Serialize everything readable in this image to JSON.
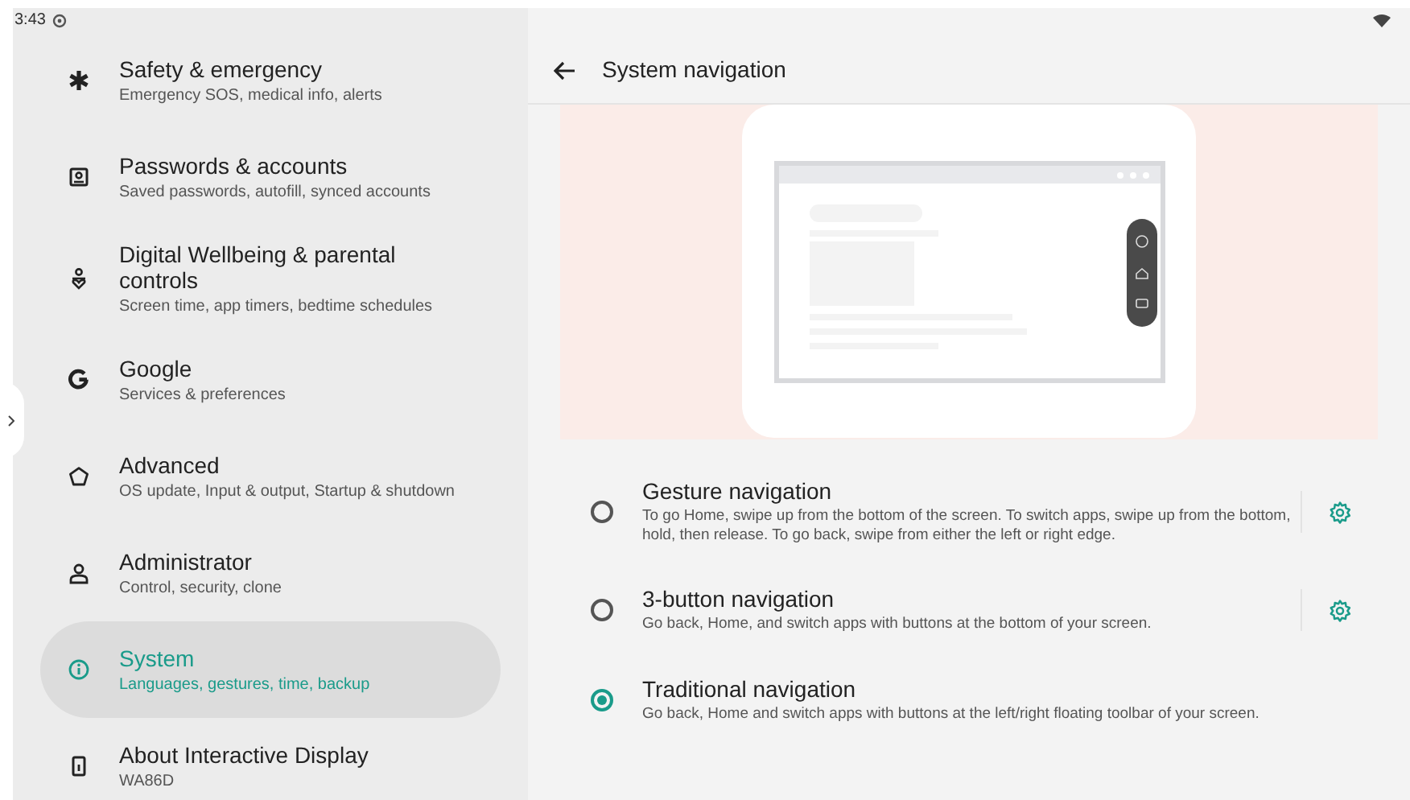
{
  "status_bar": {
    "time": "3:43"
  },
  "sidebar": {
    "items": [
      {
        "title": "Safety & emergency",
        "subtitle": "Emergency SOS, medical info, alerts",
        "selected": false
      },
      {
        "title": "Passwords & accounts",
        "subtitle": "Saved passwords, autofill, synced accounts",
        "selected": false
      },
      {
        "title": "Digital Wellbeing & parental controls",
        "subtitle": "Screen time, app timers, bedtime schedules",
        "selected": false
      },
      {
        "title": "Google",
        "subtitle": "Services & preferences",
        "selected": false
      },
      {
        "title": "Advanced",
        "subtitle": "OS update, Input & output, Startup & shutdown",
        "selected": false
      },
      {
        "title": "Administrator",
        "subtitle": "Control, security, clone",
        "selected": false
      },
      {
        "title": "System",
        "subtitle": "Languages, gestures, time, backup",
        "selected": true
      },
      {
        "title": "About Interactive Display",
        "subtitle": "WA86D",
        "selected": false
      }
    ]
  },
  "page": {
    "title": "System navigation",
    "options": [
      {
        "title": "Gesture navigation",
        "description": "To go Home, swipe up from the bottom of the screen. To switch apps, swipe up from the bottom, hold, then release. To go back, swipe from either the left or right edge.",
        "selected": false,
        "settings": true
      },
      {
        "title": "3-button navigation",
        "description": "Go back, Home, and switch apps with buttons at the bottom of your screen.",
        "selected": false,
        "settings": true
      },
      {
        "title": "Traditional navigation",
        "description": "Go back, Home and switch apps with buttons at the left/right floating toolbar of your screen.",
        "selected": true,
        "settings": false
      }
    ]
  }
}
